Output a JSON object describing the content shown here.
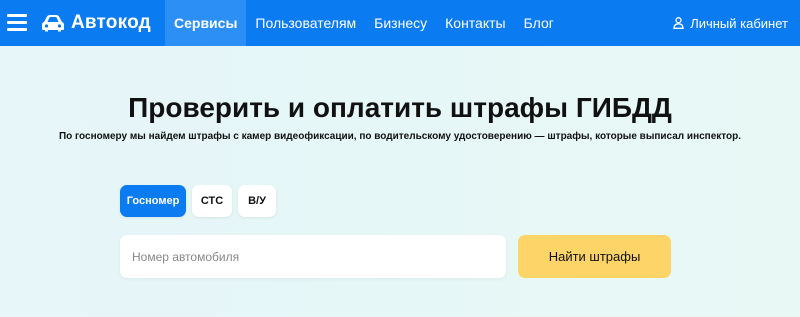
{
  "header": {
    "logo_text": "Автокод",
    "nav": [
      {
        "label": "Сервисы",
        "active": true
      },
      {
        "label": "Пользователям",
        "active": false
      },
      {
        "label": "Бизнесу",
        "active": false
      },
      {
        "label": "Контакты",
        "active": false
      },
      {
        "label": "Блог",
        "active": false
      }
    ],
    "account_label": "Личный кабинет",
    "icons": {
      "menu": "hamburger-icon",
      "logo": "car-icon",
      "account": "user-icon"
    }
  },
  "main": {
    "title": "Проверить и оплатить штрафы ГИБДД",
    "subtitle": "По госномеру мы найдем штрафы с камер видеофиксации, по водительскому удостоверению — штрафы, которые выписал инспектор.",
    "tabs": [
      {
        "label": "Госномер",
        "active": true
      },
      {
        "label": "СТС",
        "active": false
      },
      {
        "label": "В/У",
        "active": false
      }
    ],
    "input": {
      "value": "",
      "placeholder": "Номер автомобиля"
    },
    "search_button": "Найти штрафы"
  },
  "colors": {
    "brand": "#0a7bf0",
    "active_nav": "#2b8ff5",
    "button": "#fcd468"
  }
}
